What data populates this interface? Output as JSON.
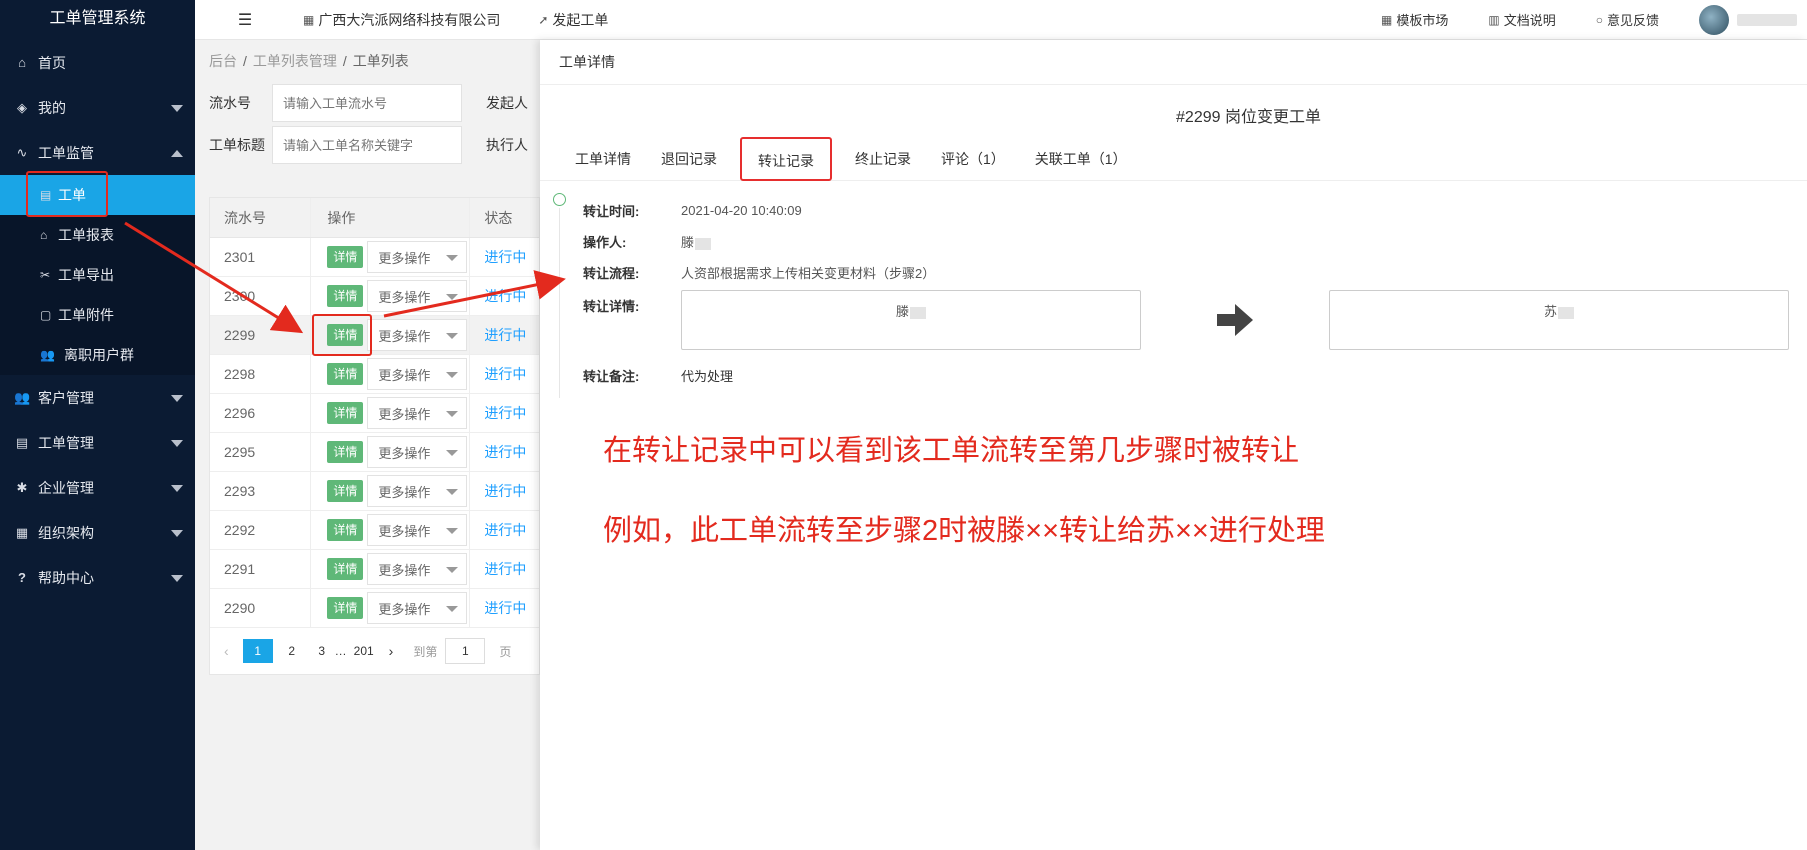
{
  "app": {
    "title": "工单管理系统"
  },
  "sidebar": {
    "items": [
      {
        "label": "首页"
      },
      {
        "label": "我的"
      },
      {
        "label": "工单监管"
      },
      {
        "label": "客户管理"
      },
      {
        "label": "工单管理"
      },
      {
        "label": "企业管理"
      },
      {
        "label": "组织架构"
      },
      {
        "label": "帮助中心"
      }
    ],
    "sub_items": [
      {
        "label": "工单"
      },
      {
        "label": "工单报表"
      },
      {
        "label": "工单导出"
      },
      {
        "label": "工单附件"
      },
      {
        "label": "离职用户群"
      }
    ]
  },
  "topbar": {
    "company": "广西大汽派网络科技有限公司",
    "start_ticket": "发起工单",
    "template_market": "模板市场",
    "docs": "文档说明",
    "feedback": "意见反馈"
  },
  "breadcrumb": {
    "root": "后台",
    "parent": "工单列表管理",
    "current": "工单列表"
  },
  "filters": {
    "serial_label": "流水号",
    "serial_placeholder": "请输入工单流水号",
    "initiator_label": "发起人",
    "title_label": "工单标题",
    "title_placeholder": "请输入工单名称关键字",
    "executor_label": "执行人"
  },
  "table": {
    "headers": {
      "serial": "流水号",
      "action": "操作",
      "status": "状态"
    },
    "detail_label": "详情",
    "more_label": "更多操作",
    "rows": [
      {
        "serial": "2301",
        "status": "进行中"
      },
      {
        "serial": "2300",
        "status": "进行中"
      },
      {
        "serial": "2299",
        "status": "进行中"
      },
      {
        "serial": "2298",
        "status": "进行中"
      },
      {
        "serial": "2296",
        "status": "进行中"
      },
      {
        "serial": "2295",
        "status": "进行中"
      },
      {
        "serial": "2293",
        "status": "进行中"
      },
      {
        "serial": "2292",
        "status": "进行中"
      },
      {
        "serial": "2291",
        "status": "进行中"
      },
      {
        "serial": "2290",
        "status": "进行中"
      }
    ]
  },
  "pagination": {
    "pages": [
      "1",
      "2",
      "3"
    ],
    "ellipsis": "…",
    "last": "201",
    "goto_label": "到第",
    "goto_value": "1",
    "page_suffix": "页"
  },
  "panel": {
    "header": "工单详情",
    "title": "#2299 岗位变更工单",
    "tabs": [
      "工单详情",
      "退回记录",
      "转让记录",
      "终止记录",
      "评论（1）",
      "关联工单（1）"
    ],
    "record": {
      "time_label": "转让时间:",
      "time_value": "2021-04-20 10:40:09",
      "operator_label": "操作人:",
      "operator_value": "滕",
      "flow_label": "转让流程:",
      "flow_value": "人资部根据需求上传相关变更材料（步骤2）",
      "detail_label": "转让详情:",
      "from": "滕",
      "to": "苏",
      "remark_label": "转让备注:",
      "remark_value": "代为处理"
    },
    "notes": [
      "在转让记录中可以看到该工单流转至第几步骤时被转让",
      "例如，此工单流转至步骤2时被滕××转让给苏××进行处理"
    ]
  },
  "colors": {
    "sidebar_bg": "#0b1b33",
    "active_blue": "#1aa5e6",
    "detail_green": "#5fb878",
    "status_blue": "#1e9fff",
    "annotation_red": "#e32a1e"
  }
}
